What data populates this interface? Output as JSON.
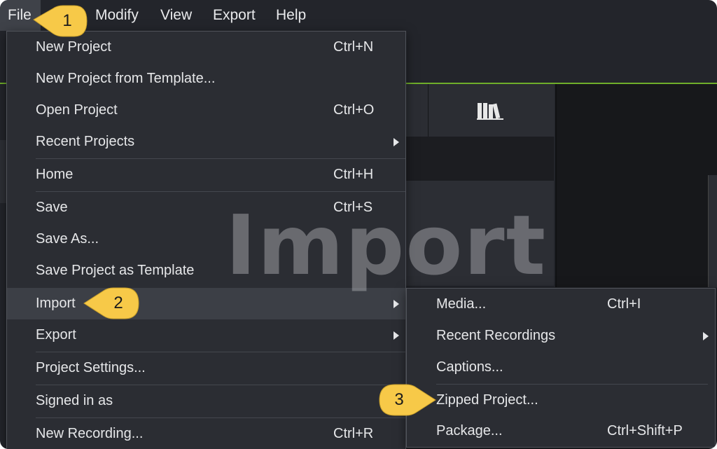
{
  "menubar": {
    "items": [
      "File",
      "Modify",
      "View",
      "Export",
      "Help"
    ]
  },
  "file_menu": {
    "items": [
      {
        "label": "New Project",
        "shortcut": "Ctrl+N"
      },
      {
        "label": "New Project from Template...",
        "shortcut": ""
      },
      {
        "label": "Open Project",
        "shortcut": "Ctrl+O"
      },
      {
        "label": "Recent Projects",
        "shortcut": ""
      },
      {
        "label": "Home",
        "shortcut": "Ctrl+H"
      },
      {
        "label": "Save",
        "shortcut": "Ctrl+S"
      },
      {
        "label": "Save As...",
        "shortcut": ""
      },
      {
        "label": "Save Project as Template",
        "shortcut": ""
      },
      {
        "label": "Import",
        "shortcut": ""
      },
      {
        "label": "Export",
        "shortcut": ""
      },
      {
        "label": "Project Settings...",
        "shortcut": ""
      },
      {
        "label": "Signed in as",
        "shortcut": ""
      },
      {
        "label": "New Recording...",
        "shortcut": "Ctrl+R"
      }
    ]
  },
  "import_menu": {
    "items": [
      {
        "label": "Media...",
        "shortcut": "Ctrl+I"
      },
      {
        "label": "Recent Recordings",
        "shortcut": ""
      },
      {
        "label": "Captions...",
        "shortcut": ""
      },
      {
        "label": "Zipped Project...",
        "shortcut": ""
      },
      {
        "label": "Package...",
        "shortcut": "Ctrl+Shift+P"
      }
    ]
  },
  "watermark": "Import",
  "callouts": [
    "1",
    "2",
    "3"
  ],
  "colors": {
    "background": "#23252b",
    "menu": "#2b2d33",
    "highlight": "#3c3f46",
    "accent_green": "#6fae2a",
    "callout_yellow": "#f7c948"
  },
  "icons": [
    "library-icon",
    "submenu-arrow-icon"
  ]
}
